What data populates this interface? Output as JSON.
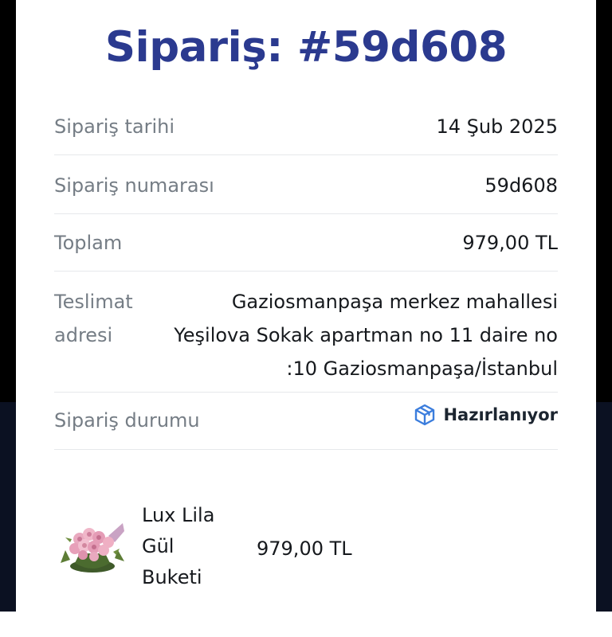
{
  "header": {
    "title": "Sipariş: #59d608"
  },
  "details": {
    "date": {
      "label": "Sipariş tarihi",
      "value": "14 Şub 2025"
    },
    "number": {
      "label": "Sipariş numarası",
      "value": "59d608"
    },
    "total": {
      "label": "Toplam",
      "value": "979,00 TL"
    },
    "address": {
      "label": "Teslimat adresi",
      "value": "Gaziosmanpaşa merkez mahallesi Yeşilova Sokak apartman no 11 daire no :10 Gaziosmanpaşa/İstanbul"
    },
    "status": {
      "label": "Sipariş durumu",
      "value": "Hazırlanıyor",
      "icon": "box-icon",
      "icon_color": "#3b7ddd"
    }
  },
  "product": {
    "name": "Lux Lila Gül Buketi",
    "price": "979,00 TL",
    "thumbnail": "flower-bouquet-image"
  },
  "colors": {
    "title": "#2b3a8f",
    "label": "#757d85",
    "value": "#16191d",
    "divider": "#e6e8eb",
    "status_icon": "#3b7ddd"
  }
}
